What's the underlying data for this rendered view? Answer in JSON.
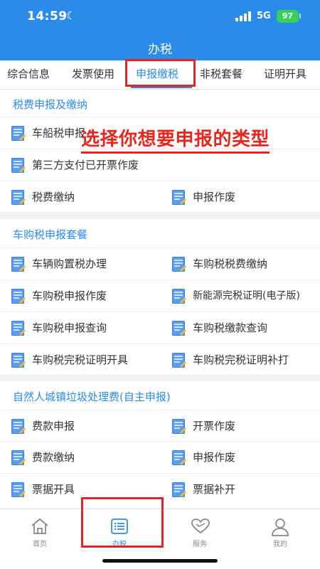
{
  "status_bar": {
    "time": "14:59",
    "network": "5G",
    "battery": "97"
  },
  "header": {
    "title": "办税"
  },
  "tabs": [
    {
      "label": "综合信息",
      "active": false
    },
    {
      "label": "发票使用",
      "active": false
    },
    {
      "label": "申报缴税",
      "active": true
    },
    {
      "label": "非税套餐",
      "active": false
    },
    {
      "label": "证明开具",
      "active": false
    }
  ],
  "sections": {
    "tax_filing": {
      "title": "税费申报及缴纳",
      "items": [
        "车船税申报",
        "第三方支付已开票作废",
        "税费缴纳",
        "申报作废"
      ]
    },
    "vehicle_tax": {
      "title": "车购税申报套餐",
      "items": [
        "车辆购置税办理",
        "车购税税费缴纳",
        "车购税申报作废",
        "新能源完税证明(电子版)",
        "车购税申报查询",
        "车购税缴款查询",
        "车购税完税证明开具",
        "车购税完税证明补打"
      ]
    },
    "garbage_fee": {
      "title": "自然人城镇垃圾处理费(自主申报)",
      "items": [
        "费款申报",
        "开票作废",
        "费款缴纳",
        "申报作废",
        "票据开具",
        "票据补开"
      ]
    }
  },
  "annotation": {
    "text": "选择你想要申报的类型"
  },
  "bottom_nav": [
    {
      "label": "首页",
      "icon": "home-icon",
      "active": false
    },
    {
      "label": "办税",
      "icon": "list-icon",
      "active": true
    },
    {
      "label": "服务",
      "icon": "heart-icon",
      "active": false
    },
    {
      "label": "我的",
      "icon": "person-icon",
      "active": false
    }
  ],
  "colors": {
    "brand": "#2b8be9",
    "highlight": "#e0252b",
    "annotation": "#e8261e",
    "battery": "#37d05a"
  }
}
